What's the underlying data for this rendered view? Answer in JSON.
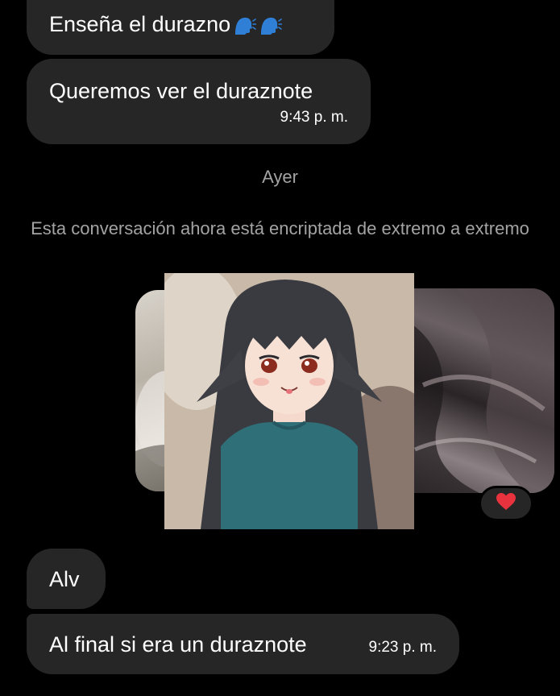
{
  "messages": [
    {
      "text": "Enseña el durazno",
      "emojis": [
        "speaking-head-icon",
        "speaking-head-icon"
      ]
    },
    {
      "text": "Queremos ver el duraznote",
      "time": "9:43 p. m."
    },
    {
      "text": "Alv"
    },
    {
      "text": "Al final si era un duraznote",
      "time": "9:23 p. m."
    }
  ],
  "day_separator": "Ayer",
  "encryption_notice": "Esta conversación ahora está encriptada de extremo a extremo",
  "reaction": {
    "icon": "red-heart-icon",
    "color": "#e8333f"
  },
  "colors": {
    "background": "#000000",
    "bubble": "#262626",
    "muted_text": "#a3a3a3",
    "emoji_blue": "#2f7fd6"
  }
}
